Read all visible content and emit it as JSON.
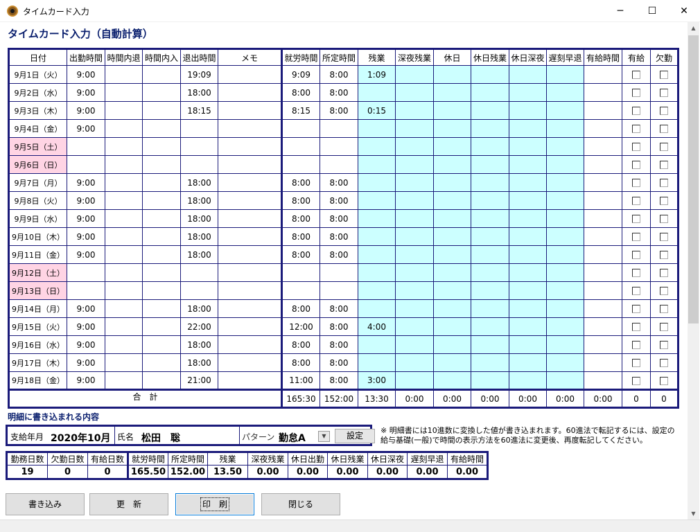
{
  "window": {
    "title": "タイムカード入力",
    "min": "─",
    "max": "☐",
    "close": "✕"
  },
  "heading": "タイムカード入力（自動計算）",
  "table": {
    "headers": [
      "日付",
      "出勤時間",
      "時間内退",
      "時間内入",
      "退出時間",
      "メモ",
      "就労時間",
      "所定時間",
      "残業",
      "深夜残業",
      "休日",
      "休日残業",
      "休日深夜",
      "遅刻早退",
      "有給時間",
      "有給",
      "欠勤"
    ],
    "rows": [
      {
        "date": "9月1日（火）",
        "in": "9:00",
        "out": "19:09",
        "work": "9:09",
        "std": "8:00",
        "ot": "1:09",
        "holiday": false
      },
      {
        "date": "9月2日（水）",
        "in": "9:00",
        "out": "18:00",
        "work": "8:00",
        "std": "8:00",
        "ot": "",
        "holiday": false
      },
      {
        "date": "9月3日（木）",
        "in": "9:00",
        "out": "18:15",
        "work": "8:15",
        "std": "8:00",
        "ot": "0:15",
        "holiday": false
      },
      {
        "date": "9月4日（金）",
        "in": "9:00",
        "out": "",
        "work": "",
        "std": "",
        "ot": "",
        "holiday": false
      },
      {
        "date": "9月5日（土）",
        "in": "",
        "out": "",
        "work": "",
        "std": "",
        "ot": "",
        "holiday": true
      },
      {
        "date": "9月6日（日）",
        "in": "",
        "out": "",
        "work": "",
        "std": "",
        "ot": "",
        "holiday": true
      },
      {
        "date": "9月7日（月）",
        "in": "9:00",
        "out": "18:00",
        "work": "8:00",
        "std": "8:00",
        "ot": "",
        "holiday": false
      },
      {
        "date": "9月8日（火）",
        "in": "9:00",
        "out": "18:00",
        "work": "8:00",
        "std": "8:00",
        "ot": "",
        "holiday": false
      },
      {
        "date": "9月9日（水）",
        "in": "9:00",
        "out": "18:00",
        "work": "8:00",
        "std": "8:00",
        "ot": "",
        "holiday": false
      },
      {
        "date": "9月10日（木）",
        "in": "9:00",
        "out": "18:00",
        "work": "8:00",
        "std": "8:00",
        "ot": "",
        "holiday": false
      },
      {
        "date": "9月11日（金）",
        "in": "9:00",
        "out": "18:00",
        "work": "8:00",
        "std": "8:00",
        "ot": "",
        "holiday": false
      },
      {
        "date": "9月12日（土）",
        "in": "",
        "out": "",
        "work": "",
        "std": "",
        "ot": "",
        "holiday": true
      },
      {
        "date": "9月13日（日）",
        "in": "",
        "out": "",
        "work": "",
        "std": "",
        "ot": "",
        "holiday": true
      },
      {
        "date": "9月14日（月）",
        "in": "9:00",
        "out": "18:00",
        "work": "8:00",
        "std": "8:00",
        "ot": "",
        "holiday": false
      },
      {
        "date": "9月15日（火）",
        "in": "9:00",
        "out": "22:00",
        "work": "12:00",
        "std": "8:00",
        "ot": "4:00",
        "holiday": false
      },
      {
        "date": "9月16日（水）",
        "in": "9:00",
        "out": "18:00",
        "work": "8:00",
        "std": "8:00",
        "ot": "",
        "holiday": false
      },
      {
        "date": "9月17日（木）",
        "in": "9:00",
        "out": "18:00",
        "work": "8:00",
        "std": "8:00",
        "ot": "",
        "holiday": false
      },
      {
        "date": "9月18日（金）",
        "in": "9:00",
        "out": "21:00",
        "work": "11:00",
        "std": "8:00",
        "ot": "3:00",
        "holiday": false
      }
    ],
    "total_label": "合　計",
    "totals": [
      "165:30",
      "152:00",
      "13:30",
      "0:00",
      "0:00",
      "0:00",
      "0:00",
      "0:00",
      "0:00",
      "0",
      "0"
    ]
  },
  "detail": {
    "section_title": "明細に書き込まれる内容",
    "pay_month_label": "支給年月",
    "pay_month": "2020年10月",
    "name_label": "氏名",
    "name": "松田　聡",
    "pattern_label": "パターン",
    "pattern": "勤怠A",
    "set_button": "設定",
    "notice": "※ 明細書には10進数に変換した値が書き込まれます。60進法で転記するには、設定の給与基礎(一般)で時間の表示方法を60進法に変更後、再度転記してください。"
  },
  "summary": {
    "headers": [
      "勤務日数",
      "欠勤日数",
      "有給日数",
      "就労時間",
      "所定時間",
      "残業",
      "深夜残業",
      "休日出勤",
      "休日残業",
      "休日深夜",
      "遅刻早退",
      "有給時間"
    ],
    "values": [
      "19",
      "0",
      "0",
      "165.50",
      "152.00",
      "13.50",
      "0.00",
      "0.00",
      "0.00",
      "0.00",
      "0.00",
      "0.00"
    ]
  },
  "buttons": {
    "write": "書き込み",
    "update": "更　新",
    "print": "印　刷",
    "close": "閉じる"
  }
}
